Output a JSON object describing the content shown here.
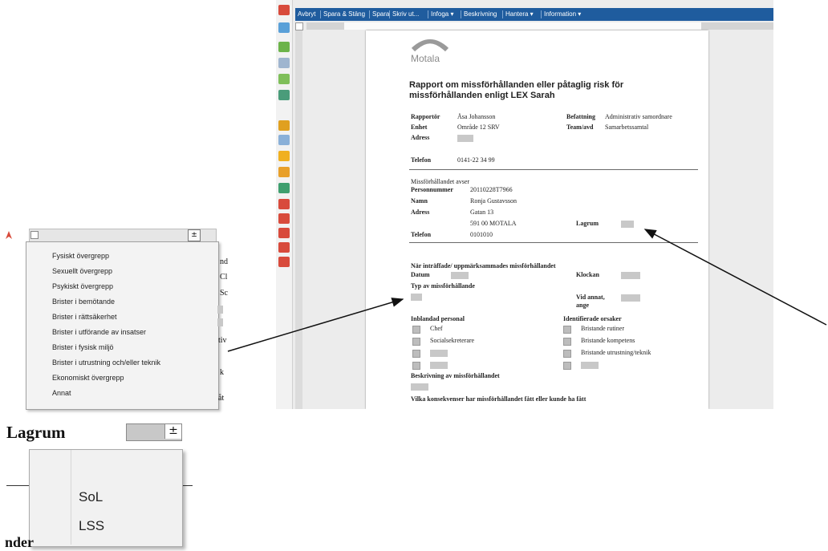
{
  "toolbar": {
    "items": [
      "Avbryt",
      "Spara & Stäng",
      "Spara",
      "Skriv ut...",
      "Infoga ▾",
      "Beskrivning",
      "Hantera ▾",
      "Information ▾"
    ]
  },
  "doc": {
    "logo_text": "Motala",
    "title_line1": "Rapport om missförhållanden eller påtaglig risk för",
    "title_line2": "missförhållanden enligt LEX Sarah",
    "rapportor_label": "Rapportör",
    "rapportor_value": "Åsa Johansson",
    "befattning_label": "Befattning",
    "befattning_value": "Administrativ samordnare",
    "enhet_label": "Enhet",
    "enhet_value": "Område 12 SRV",
    "team_label": "Team/avd",
    "team_value": "Samarbetssamtal",
    "adress_label": "Adress",
    "telefon_label": "Telefon",
    "telefon_value": "0141-22 34 99",
    "avser_label": "Missförhållandet avser",
    "personnummer_label": "Personnummer",
    "personnummer_value": "20110228T7966",
    "namn_label": "Namn",
    "namn_value": "Ronja Gustavsson",
    "adress2_label": "Adress",
    "adress2_value": "Gatan 13",
    "postort_value": "591 00  MOTALA",
    "lagrum_label": "Lagrum",
    "telefon2_label": "Telefon",
    "telefon2_value": "0101010",
    "nar_label": "När inträffade/ uppmärksammades missförhållandet",
    "datum_label": "Datum",
    "klockan_label": "Klockan",
    "typ_label": "Typ av missförhållande",
    "vid_annat_label": "Vid annat,",
    "ange_label": "ange",
    "inblandad_label": "Inblandad personal",
    "orsaker_label": "Identifierade orsaker",
    "chef_label": "Chef",
    "social_label": "Socialsekreterare",
    "rutiner_label": "Bristande rutiner",
    "kompetens_label": "Bristande kompetens",
    "utrustning_label": "Bristande utrustning/teknik",
    "beskrivning_label": "Beskrivning av missförhållandet",
    "konsekvenser_label": "Vilka konsekvenser har missförhållandet fått eller kunde ha fått"
  },
  "type_menu": {
    "button_glyph": "±",
    "items": [
      "Fysiskt övergrepp",
      "Sexuellt övergrepp",
      "Psykiskt övergrepp",
      "Brister i bemötande",
      "Brister i rättsäkerhet",
      "Brister i utförande av insatser",
      "Brister i fysisk miljö",
      "Brister i utrustning och/eller teknik",
      "Ekonomiskt övergrepp",
      "Annat"
    ],
    "cut_fragments": [
      "nd",
      "Cl",
      "Sc",
      "tiv",
      "k",
      "åt"
    ]
  },
  "lagrum_zoom": {
    "label": "Lagrum",
    "button_glyph": "±",
    "options": [
      "SoL",
      "LSS"
    ],
    "cut_text": "nder"
  }
}
